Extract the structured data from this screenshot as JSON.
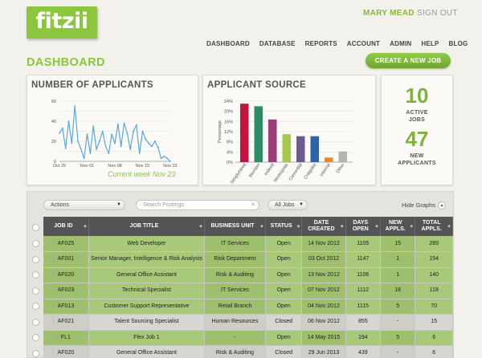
{
  "brand": {
    "logo": "fitzii",
    "color": "#8cc63f"
  },
  "header": {
    "user_name": "MARY MEAD",
    "sign_out": "SIGN OUT"
  },
  "nav": [
    "DASHBOARD",
    "DATABASE",
    "REPORTS",
    "ACCOUNT",
    "ADMIN",
    "HELP",
    "BLOG"
  ],
  "page": {
    "title": "DASHBOARD",
    "create_button": "CREATE A NEW JOB"
  },
  "applicants_panel": {
    "title": "NUMBER OF APPLICANTS",
    "week_label": "Current week Nov 23"
  },
  "source_panel": {
    "title": "APPLICANT SOURCE"
  },
  "stats": {
    "active_jobs": "10",
    "active_jobs_label_1": "ACTIVE",
    "active_jobs_label_2": "JOBS",
    "new_applicants": "47",
    "new_applicants_label_1": "NEW",
    "new_applicants_label_2": "APPLICANTS"
  },
  "chart_data": [
    {
      "type": "line",
      "x_ticks": [
        "Oct 25",
        "Nov 01",
        "Nov 08",
        "Nov 15",
        "Nov 22"
      ],
      "y_ticks": [
        "0",
        "10",
        "20",
        "30",
        "40",
        "50",
        "60"
      ],
      "ylim": [
        0,
        60
      ],
      "values": [
        28,
        33,
        13,
        40,
        18,
        55,
        20,
        12,
        3,
        27,
        8,
        35,
        12,
        20,
        30,
        15,
        8,
        27,
        18,
        37,
        15,
        38,
        28,
        12,
        30,
        36,
        8,
        30,
        22,
        18,
        15,
        20,
        14,
        3,
        5,
        3,
        0
      ],
      "line_color": "#4aa3df"
    },
    {
      "type": "bar",
      "ylabel": "Percentage",
      "y_ticks": [
        "0%",
        "4%",
        "8%",
        "12%",
        "16%",
        "20%",
        "24%"
      ],
      "ylim": [
        0,
        24
      ],
      "categories": [
        "SimplyHired",
        "Monster",
        "Indeed",
        "Workopolis",
        "CareerBld",
        "Craigslist",
        "Internal",
        "Other"
      ],
      "values": [
        23,
        22,
        16.8,
        11,
        10.2,
        10.2,
        1.8,
        4.2
      ],
      "colors": [
        "#c3143f",
        "#2e8b64",
        "#9b3d78",
        "#a2c94c",
        "#6a5a8e",
        "#2e63a8",
        "#e8862a",
        "#b3b3b3"
      ]
    }
  ],
  "toolbar": {
    "actions": "Actions",
    "search_placeholder": "Search Postings",
    "filter": "All Jobs",
    "hide_graphs": "Hide Graphs"
  },
  "table": {
    "headers": [
      "JOB ID",
      "JOB TITLE",
      "BUSINESS UNIT",
      "STATUS",
      "DATE CREATED",
      "DAYS OPEN",
      "NEW APPLS.",
      "TOTAL APPLS."
    ],
    "rows": [
      {
        "id": "AF025",
        "title": "Web Developer",
        "unit": "IT Services",
        "status": "Open",
        "date": "14 Nov 2012",
        "days": "1105",
        "new": "15",
        "total": "289"
      },
      {
        "id": "AF001",
        "title": "Senior Manager, Intelligence & Risk Analysis",
        "unit": "Risk Department",
        "status": "Open",
        "date": "03 Oct 2012",
        "days": "1147",
        "new": "1",
        "total": "154"
      },
      {
        "id": "AF020",
        "title": "General Office Assistant",
        "unit": "Risk & Auditing",
        "status": "Open",
        "date": "13 Nov 2012",
        "days": "1106",
        "new": "1",
        "total": "140"
      },
      {
        "id": "AF023",
        "title": "Technical Specialist",
        "unit": "IT Services",
        "status": "Open",
        "date": "07 Nov 2012",
        "days": "1112",
        "new": "18",
        "total": "118"
      },
      {
        "id": "AF013",
        "title": "Customer Support Representative",
        "unit": "Retail Branch",
        "status": "Open",
        "date": "04 Nov 2012",
        "days": "1115",
        "new": "5",
        "total": "70"
      },
      {
        "id": "AF021",
        "title": "Talent Sourcing Specialist",
        "unit": "Human Resources",
        "status": "Closed",
        "date": "06 Nov 2012",
        "days": "855",
        "new": "-",
        "total": "15"
      },
      {
        "id": "FL1",
        "title": "Flex Job 1",
        "unit": "-",
        "status": "Open",
        "date": "14 May 2015",
        "days": "194",
        "new": "5",
        "total": "6"
      },
      {
        "id": "AF020",
        "title": "General Office Assistant",
        "unit": "Risk & Auditing",
        "status": "Closed",
        "date": "29 Jun 2013",
        "days": "439",
        "new": "-",
        "total": "6"
      }
    ]
  }
}
